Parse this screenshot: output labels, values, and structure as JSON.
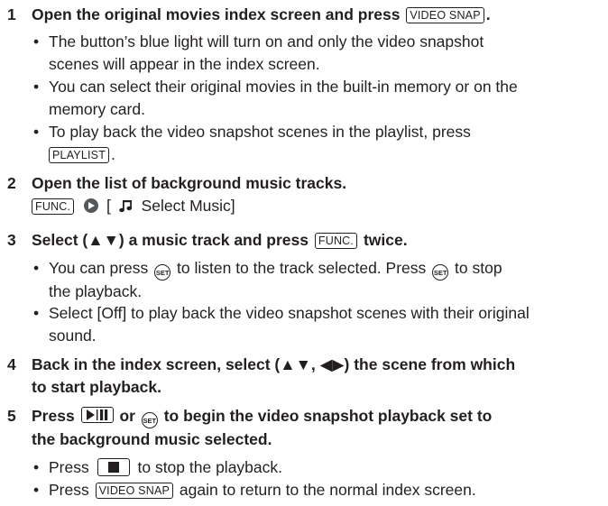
{
  "steps": [
    {
      "number": "1",
      "text_before": "Open the original movies index screen and press",
      "key": "VIDEO SNAP",
      "text_after": ".",
      "bullets": [
        {
          "line1": "The button’s blue light will turn on and only the video snapshot",
          "line2": "scenes will appear in the index screen."
        },
        {
          "line1": "You can select their original movies in the built-in memory or on the",
          "line2": "memory card."
        },
        {
          "line1": "To play back the video snapshot scenes in the playlist, press",
          "key": "PLAYLIST",
          "after": "."
        }
      ]
    },
    {
      "number": "2",
      "text": "Open the list of background music tracks.",
      "func_key": "FUNC.",
      "bracket_open": "[",
      "music_icon": "music-note-icon",
      "menu_item": "Select Music]"
    },
    {
      "number": "3",
      "text_before": "Select (▲▼) a music track and press",
      "key": "FUNC.",
      "text_after": "twice.",
      "bullets": [
        {
          "before": "You can press",
          "set_label": "SET",
          "mid": "to listen to the track selected. Press",
          "end": "to stop",
          "line2": "the playback."
        },
        {
          "line1": "Select [Off] to play back the video snapshot scenes with their original",
          "line2": "sound."
        }
      ]
    },
    {
      "number": "4",
      "line1": "Back in the index screen, select (▲▼, ◀▶) the scene from which",
      "line2": "to start playback."
    },
    {
      "number": "5",
      "text_press": "Press",
      "text_or": "or",
      "line1_rest": "to begin the video snapshot playback set to",
      "line2": "the background music selected.",
      "bullets": [
        {
          "before": "Press",
          "after": "to stop the playback."
        },
        {
          "before": "Press",
          "key": "VIDEO SNAP",
          "after": "again to return to the normal index screen."
        }
      ]
    }
  ],
  "bullet_char": "•",
  "set_label": "SET"
}
